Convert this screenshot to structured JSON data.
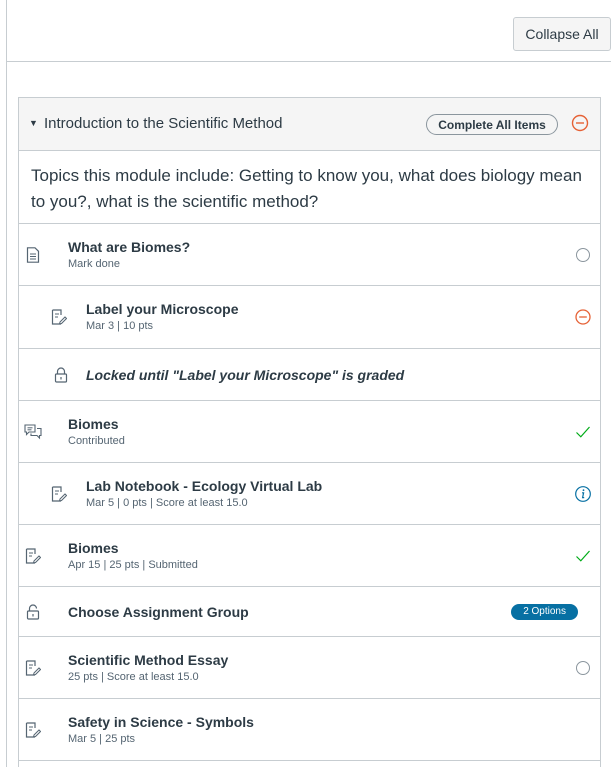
{
  "toolbar": {
    "collapse_label": "Collapse All"
  },
  "module": {
    "title": "Introduction to the Scientific Method",
    "complete_label": "Complete All Items",
    "overview": "Topics this module include: Getting to know you, what does biology mean to you?, what is the scientific method?",
    "items": [
      {
        "name": "What are Biomes?",
        "meta": "Mark done",
        "icon": "page-icon",
        "status": "empty-circle-icon"
      },
      {
        "name": "Label your Microscope",
        "meta": "Mar 3  |  10 pts",
        "icon": "assignment-icon",
        "status": "minus-circle-icon"
      },
      {
        "name": "Locked until \"Label your Microscope\" is graded",
        "icon": "lock-icon"
      },
      {
        "name": "Biomes",
        "meta": "Contributed",
        "icon": "discussion-icon",
        "status": "check-icon"
      },
      {
        "name": "Lab Notebook - Ecology Virtual Lab",
        "meta": "Mar 5  |  0 pts  |  Score at least 15.0",
        "icon": "assignment-icon",
        "status": "info-icon"
      },
      {
        "name": "Biomes",
        "meta": "Apr 15  |  25 pts  |  Submitted",
        "icon": "assignment-icon",
        "status": "check-icon"
      },
      {
        "name": "Choose Assignment Group",
        "icon": "unlock-icon",
        "badge": "2 Options"
      },
      {
        "name": "Scientific Method Essay",
        "meta": "25 pts  |  Score at least 15.0",
        "icon": "assignment-icon",
        "status": "empty-circle-icon"
      },
      {
        "name": "Safety in Science - Symbols",
        "meta": "Mar 5  |  25 pts",
        "icon": "assignment-icon"
      }
    ]
  },
  "colors": {
    "border": "#c7cdd1",
    "header_bg": "#f5f5f5",
    "text": "#2d3b45",
    "meta_text": "#556572",
    "check": "#00ac18",
    "minus": "#e66135",
    "info": "#0770a3",
    "badge": "#0770a3"
  }
}
